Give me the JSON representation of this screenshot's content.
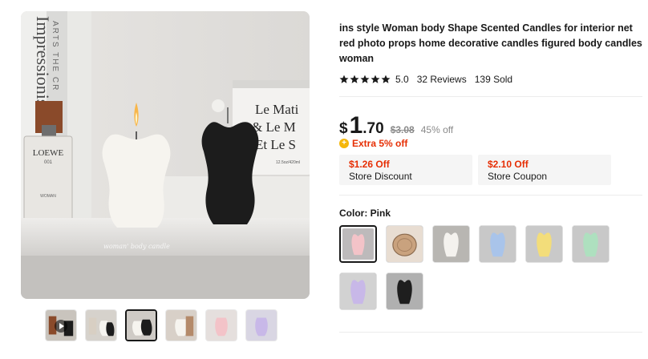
{
  "product": {
    "title": "ins style Woman body Shape Scented Candles for interior net red photo props home decorative candles figured body candles woman",
    "rating": "5.0",
    "reviews": "32 Reviews",
    "sold": "139 Sold",
    "star_count": 5,
    "star_color": "#191919"
  },
  "price": {
    "currency": "$",
    "integer": "1",
    "decimal": ".70",
    "original": "$3.08",
    "discount": "45% off",
    "extra": "Extra 5% off",
    "accent_color": "#e62e04"
  },
  "coupons": [
    {
      "amount": "$1.26 Off",
      "label": "Store Discount"
    },
    {
      "amount": "$2.10 Off",
      "label": "Store Coupon"
    }
  ],
  "color": {
    "label": "Color: Pink",
    "options": [
      {
        "name": "pink-body-candle",
        "fill": "#f3c3c8",
        "bg": "#bdbabb",
        "selected": true
      },
      {
        "name": "wood-disc-candle",
        "fill": "#c9a27e",
        "bg": "#e8ddd2"
      },
      {
        "name": "white-body-candle",
        "fill": "#f4f2ee",
        "bg": "#b8b6b2"
      },
      {
        "name": "blue-body-candle",
        "fill": "#a9c4ea",
        "bg": "#c8c8c8"
      },
      {
        "name": "yellow-body-candle",
        "fill": "#f3dd7a",
        "bg": "#c9c9c9"
      },
      {
        "name": "green-body-candle",
        "fill": "#aee0bf",
        "bg": "#c8c8c8"
      },
      {
        "name": "purple-body-candle",
        "fill": "#c8b8e8",
        "bg": "#d2d2d2"
      },
      {
        "name": "black-body-candle",
        "fill": "#1e1e1e",
        "bg": "#b0b0b0"
      }
    ]
  },
  "gallery": {
    "image_text": {
      "book_title": "Impressionist",
      "book_subtitle": "ARTS THE CR",
      "bottle_brand": "LOEWE",
      "bottle_number": "001",
      "bottle_sub": "WOMAN",
      "jar_line1": "Le Mati",
      "jar_line2": "& Le M",
      "jar_line3": "Et Le S",
      "jar_small": "12.5oz/420ml",
      "shelf_script": "woman' body candle"
    },
    "thumbnails": [
      {
        "name": "video-thumb",
        "tone": "#c9c4bd",
        "video": true
      },
      {
        "name": "thumb-2",
        "tone": "#d6d2cc"
      },
      {
        "name": "thumb-3",
        "tone": "#cfcbc6",
        "selected": true
      },
      {
        "name": "thumb-4",
        "tone": "#d8d0c8"
      },
      {
        "name": "thumb-5",
        "tone": "#e5dfdd"
      },
      {
        "name": "thumb-6",
        "tone": "#d9d6e3"
      }
    ]
  }
}
